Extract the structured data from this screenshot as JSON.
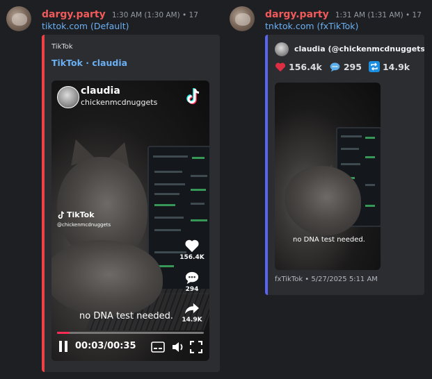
{
  "posts": [
    {
      "username": "dargy.party",
      "time": "1:30 AM (1:30 AM) • 17",
      "link": "tiktok.com (Default)",
      "embed": {
        "provider": "TikTok",
        "title": "TikTok · claudia",
        "bar_color": "#ed4245",
        "video": {
          "display_name": "claudia",
          "handle": "chickenmcdnuggets",
          "watermark": "TikTok",
          "watermark_handle": "@chickenmcdnuggets",
          "caption": "no DNA test needed.",
          "likes": "156.4K",
          "comments": "294",
          "shares": "14.9K",
          "elapsed": "00:03",
          "duration": "00:35",
          "time_display": "00:03/00:35",
          "progress_fraction": 0.0857
        }
      }
    },
    {
      "username": "dargy.party",
      "time": "1:31 AM (1:31 AM) • 17",
      "link": "tnktok.com (fxTikTok)",
      "embed": {
        "bar_color": "#5865f2",
        "author": "claudia (@chickenmcdnuggets)",
        "likes": "156.4k",
        "comments": "295",
        "shares": "14.9k",
        "caption": "no DNA test needed.",
        "footer": "fxTikTok • 5/27/2025 5:11 AM"
      }
    }
  ],
  "icons": {
    "heart": "heart-icon",
    "comment": "speech-bubble-icon",
    "share": "repeat-icon",
    "tiktok": "tiktok-logo-icon",
    "pause": "pause-icon",
    "captions": "captions-icon",
    "volume": "volume-icon",
    "fullscreen": "fullscreen-icon"
  },
  "colors": {
    "username": "#f05a5a",
    "link": "#6ab0f3",
    "background": "#1e1f22",
    "embed_bg": "#2b2d31",
    "progress_fill": "#fe2c55",
    "heart_red": "#dd2e44",
    "blue_emoji": "#1d8fe1"
  }
}
